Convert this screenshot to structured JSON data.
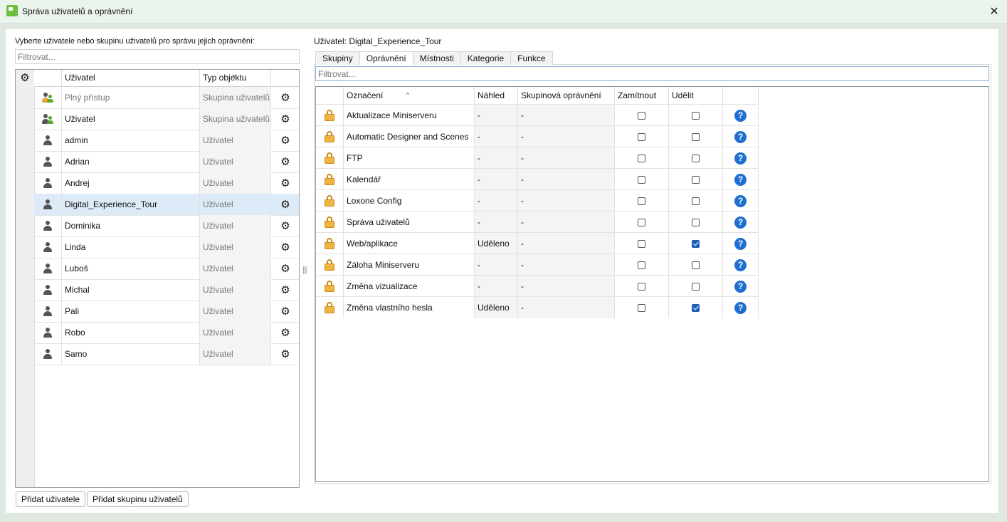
{
  "window": {
    "title": "Správa uživatelů a oprávnění",
    "close_glyph": "✕"
  },
  "left": {
    "prompt": "Vyberte uživatele nebo skupinu uživatelů pro správu jejich oprávnění:",
    "filter_placeholder": "Filtrovat...",
    "columns": {
      "user": "Uživatel",
      "type": "Typ objektu"
    },
    "rows": [
      {
        "name": "Plný přístup",
        "type": "Skupina uživatelů",
        "icon": "group-full-icon",
        "muted": true
      },
      {
        "name": "Uživatel",
        "type": "Skupina uživatelů",
        "icon": "group-icon",
        "muted": false
      },
      {
        "name": "admin",
        "type": "Uživatel",
        "icon": "user-icon"
      },
      {
        "name": "Adrian",
        "type": "Uživatel",
        "icon": "user-icon"
      },
      {
        "name": "Andrej",
        "type": "Uživatel",
        "icon": "user-icon"
      },
      {
        "name": "Digital_Experience_Tour",
        "type": "Uživatel",
        "icon": "user-icon",
        "selected": true
      },
      {
        "name": "Dominika",
        "type": "Uživatel",
        "icon": "user-icon"
      },
      {
        "name": "Linda",
        "type": "Uživatel",
        "icon": "user-icon"
      },
      {
        "name": "Luboš",
        "type": "Uživatel",
        "icon": "user-icon"
      },
      {
        "name": "Michal",
        "type": "Uživatel",
        "icon": "user-icon"
      },
      {
        "name": "Pali",
        "type": "Uživatel",
        "icon": "user-icon"
      },
      {
        "name": "Robo",
        "type": "Uživatel",
        "icon": "user-icon"
      },
      {
        "name": "Samo",
        "type": "Uživatel",
        "icon": "user-icon"
      }
    ],
    "buttons": {
      "add_user": "Přidat uživatele",
      "add_group": "Přidat skupinu uživatelů"
    }
  },
  "right": {
    "user_label": "Uživatel: Digital_Experience_Tour",
    "tabs": [
      "Skupiny",
      "Oprávnění",
      "Místnosti",
      "Kategorie",
      "Funkce"
    ],
    "active_tab": "Oprávnění",
    "filter_placeholder": "Filtrovat...",
    "columns": {
      "name": "Označení",
      "preview": "Náhled",
      "group_perm": "Skupinová oprávnění",
      "deny": "Zamítnout",
      "grant": "Udělit"
    },
    "rows": [
      {
        "name": "Aktualizace Miniserveru",
        "preview": "-",
        "group": "-",
        "deny": false,
        "grant": false
      },
      {
        "name": "Automatic Designer and Scenes",
        "preview": "-",
        "group": "-",
        "deny": false,
        "grant": false
      },
      {
        "name": "FTP",
        "preview": "-",
        "group": "-",
        "deny": false,
        "grant": false
      },
      {
        "name": "Kalendář",
        "preview": "-",
        "group": "-",
        "deny": false,
        "grant": false
      },
      {
        "name": "Loxone Config",
        "preview": "-",
        "group": "-",
        "deny": false,
        "grant": false
      },
      {
        "name": "Správa uživatelů",
        "preview": "-",
        "group": "-",
        "deny": false,
        "grant": false
      },
      {
        "name": "Web/aplikace",
        "preview": "Uděleno",
        "group": "-",
        "deny": false,
        "grant": true
      },
      {
        "name": "Záloha Miniserveru",
        "preview": "-",
        "group": "-",
        "deny": false,
        "grant": false
      },
      {
        "name": "Změna vizualizace",
        "preview": "-",
        "group": "-",
        "deny": false,
        "grant": false
      },
      {
        "name": "Změna vlastního hesla",
        "preview": "Uděleno",
        "group": "-",
        "deny": false,
        "grant": true
      }
    ]
  },
  "colors": {
    "accent": "#1f6fd0",
    "selected_row": "#ddeaf8",
    "lock": "#f2b440"
  }
}
